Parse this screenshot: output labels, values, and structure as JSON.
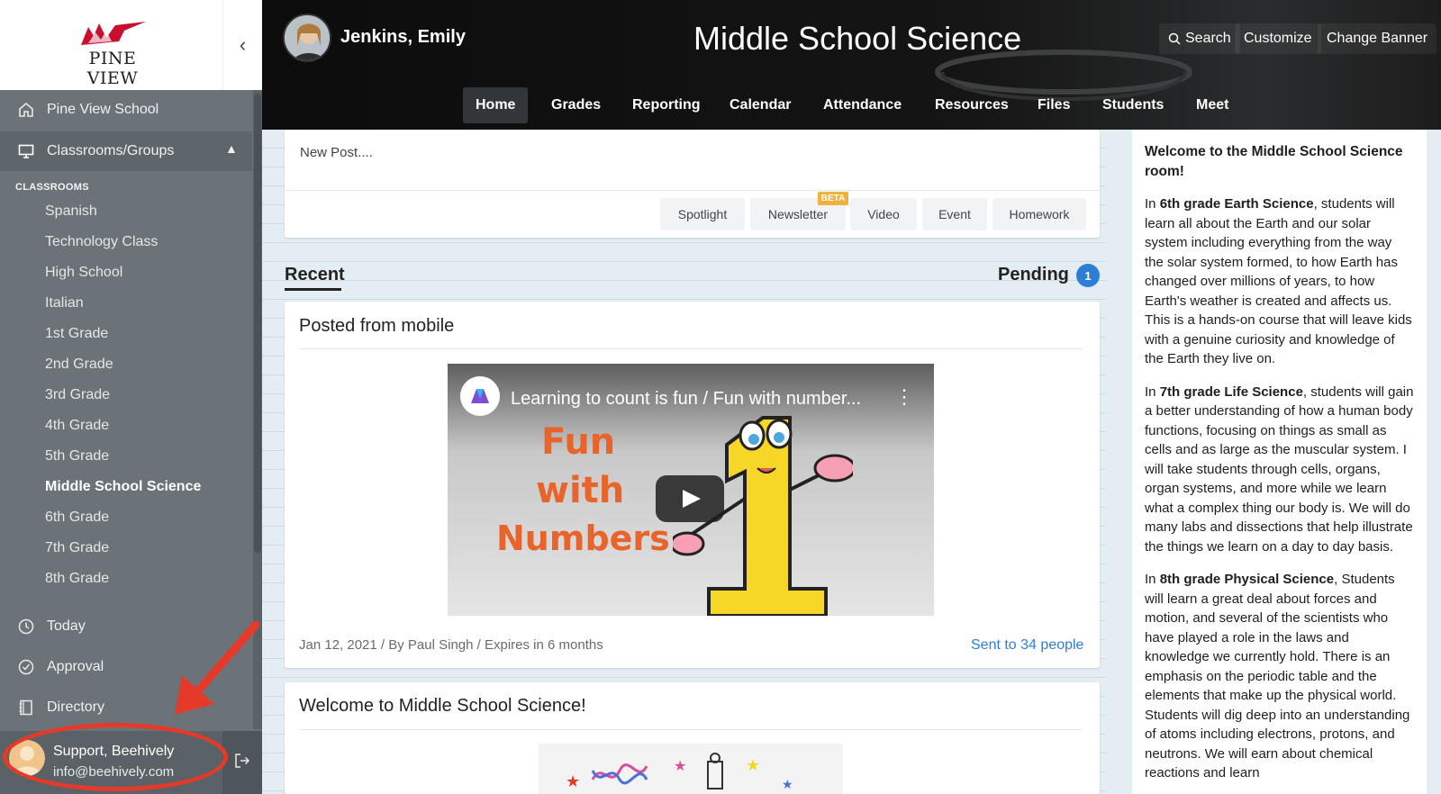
{
  "sidebar": {
    "logo_text": "PINE VIEW",
    "collapse_icon": "chevron-left-icon",
    "nav_top": [
      {
        "label": "Pine View School",
        "icon": "home-icon"
      },
      {
        "label": "Classrooms/Groups",
        "icon": "monitor-icon"
      }
    ],
    "section_label": "CLASSROOMS",
    "classrooms": [
      "Spanish",
      "Technology Class",
      "High School",
      "Italian",
      "1st Grade",
      "2nd Grade",
      "3rd Grade",
      "4th Grade",
      "5th Grade",
      "Middle School Science",
      "6th Grade",
      "7th Grade",
      "8th Grade"
    ],
    "active_classroom": "Middle School Science",
    "nav_bottom": [
      {
        "label": "Today",
        "icon": "clock-icon"
      },
      {
        "label": "Approval",
        "icon": "check-circle-icon"
      },
      {
        "label": "Directory",
        "icon": "book-icon"
      }
    ],
    "user": {
      "name": "Support, Beehively",
      "email": "info@beehively.com"
    },
    "logout_icon": "logout-icon"
  },
  "header": {
    "profile_name": "Jenkins, Emily",
    "title": "Middle School Science",
    "buttons": {
      "search": "Search",
      "customize": "Customize",
      "change_banner": "Change Banner"
    },
    "tabs": [
      "Home",
      "Grades",
      "Reporting",
      "Calendar",
      "Attendance",
      "Resources",
      "Files",
      "Students",
      "Meet"
    ],
    "active_tab": "Home"
  },
  "new_post": {
    "placeholder": "New Post....",
    "types": [
      "Spotlight",
      "Newsletter",
      "Video",
      "Event",
      "Homework"
    ],
    "beta_badge": "BETA"
  },
  "feed": {
    "recent_label": "Recent",
    "pending_label": "Pending",
    "pending_count": "1",
    "posts": [
      {
        "title": "Posted from mobile",
        "video_title": "Learning to count is fun / Fun with number...",
        "video_words": [
          "Fun",
          "with",
          "Numbers"
        ],
        "meta": "Jan 12, 2021 / By Paul Singh / Expires in 6 months",
        "sent": "Sent to 34 people"
      },
      {
        "title": "Welcome to Middle School Science!"
      }
    ]
  },
  "about": {
    "heading": "Welcome to the Middle School Science room!",
    "p1_pre": "In ",
    "p1_bold": "6th grade Earth Science",
    "p1_post": ", students will learn all about the Earth and our solar system including everything from the way the solar system formed, to how Earth has changed over millions of years, to how Earth's weather is created and affects us. This is a hands-on course that will leave kids with a genuine curiosity and knowledge of the Earth they live on.",
    "p2_pre": "In ",
    "p2_bold": "7th grade Life Science",
    "p2_post": ", students will gain a better understanding of how a human body functions, focusing on things as small as cells and as large as the muscular system. I will take students through cells, organs, organ systems, and more while we learn what a complex thing our body is. We will do many labs and dissections that help illustrate the things we learn on a day to day basis.",
    "p3_pre": "In ",
    "p3_bold": "8th grade Physical Science",
    "p3_post": ", Students will learn a great deal about forces and motion, and several of the scientists who have played a role in the laws and knowledge we currently hold. There is an emphasis on the periodic table and the elements that make up the physical world. Students will dig deep into an understanding of atoms including electrons, protons, and neutrons. We will earn about chemical reactions and learn"
  },
  "colors": {
    "accent_blue": "#2d7fd6",
    "annotation_red": "#e53a2a",
    "beta_orange": "#f1b23b"
  }
}
